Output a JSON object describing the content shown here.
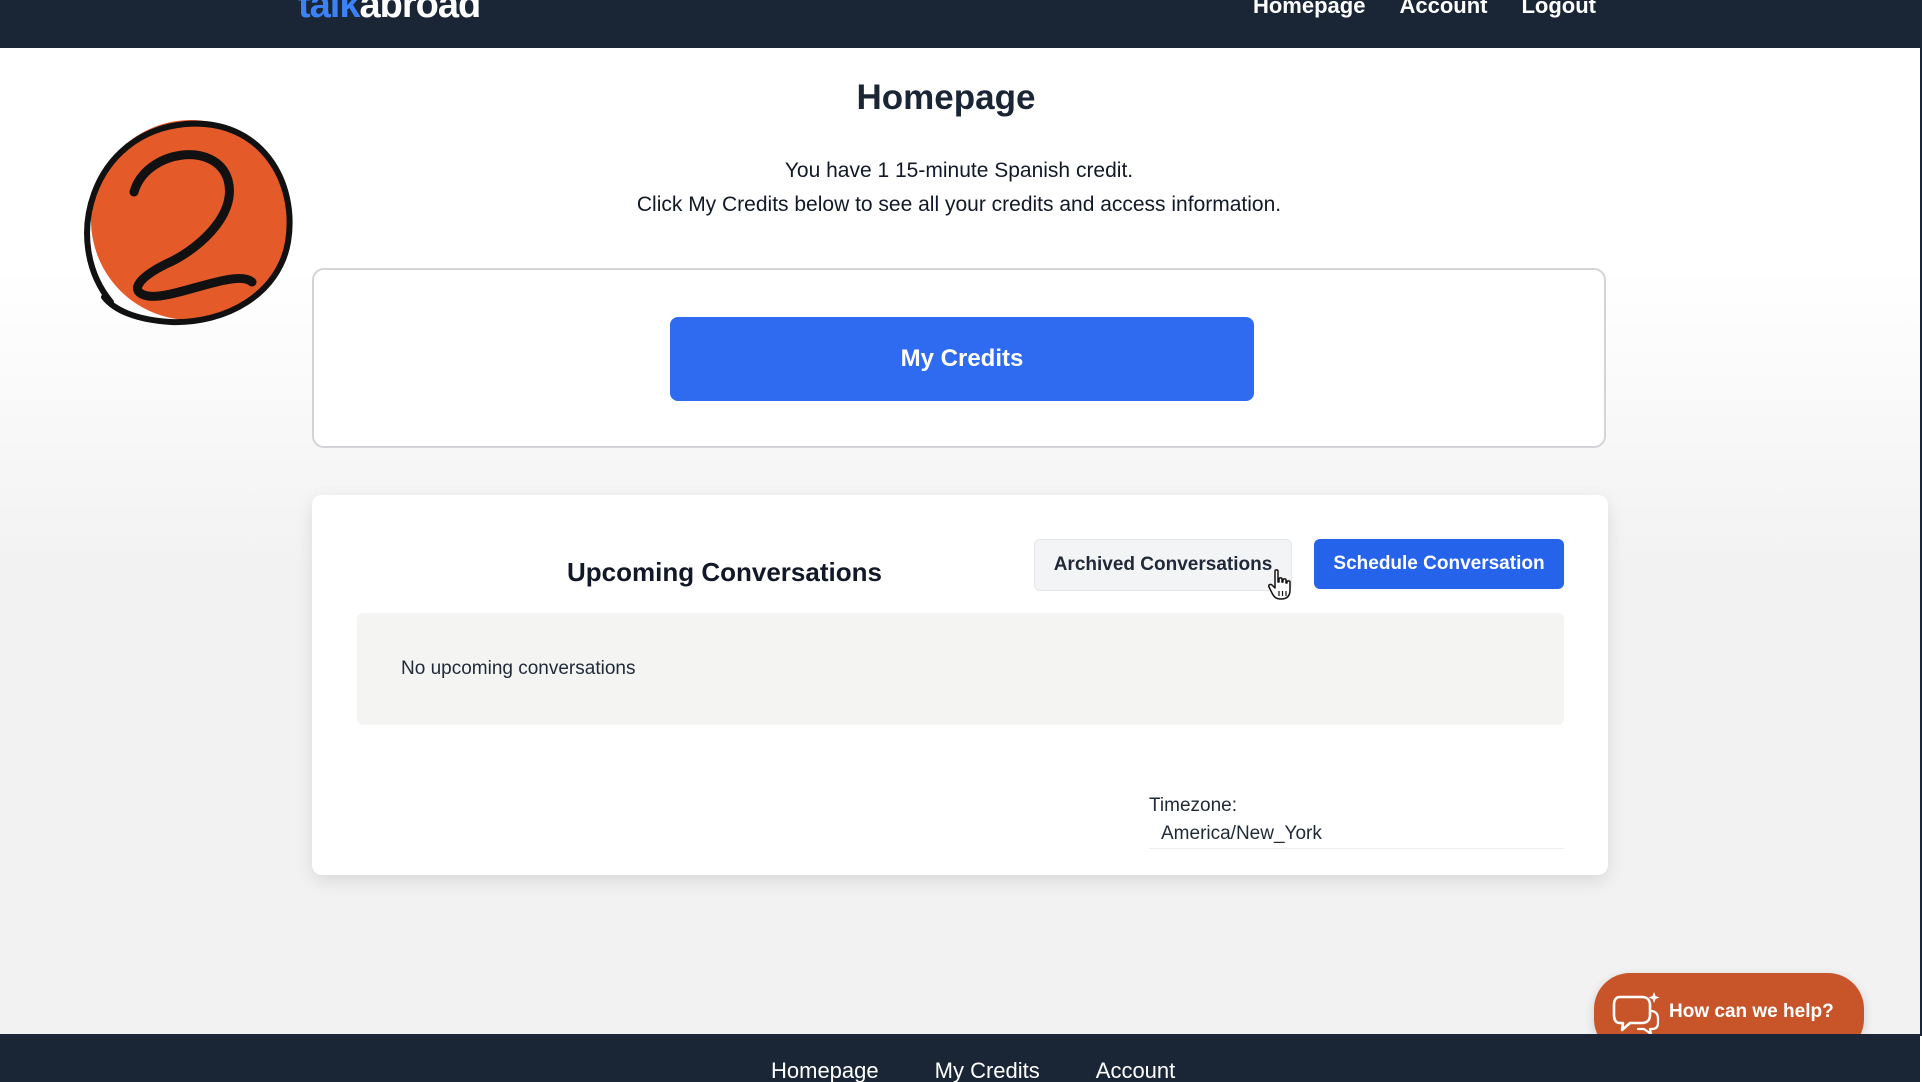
{
  "brand": {
    "logo_part_a": "talk",
    "logo_part_b": "abroad",
    "accent_color": "#3b82f6",
    "nav_color": "#1a2636"
  },
  "header": {
    "nav": [
      {
        "label": "Homepage"
      },
      {
        "label": "Account"
      },
      {
        "label": "Logout"
      }
    ]
  },
  "badge": {
    "icon": "step-2-badge-icon",
    "color": "#e55a29"
  },
  "main": {
    "title": "Homepage",
    "credit_line": "You have 1 15-minute Spanish credit.",
    "credit_hint": "Click My Credits below to see all your credits and access information."
  },
  "credits_card": {
    "button_label": "My Credits",
    "button_color": "#2f6bf0"
  },
  "conversations": {
    "title": "Upcoming Conversations",
    "archived_label": "Archived Conversations",
    "schedule_label": "Schedule Conversation",
    "empty_text": "No upcoming conversations",
    "timezone_label": "Timezone:",
    "timezone_value": "America/New_York"
  },
  "help": {
    "label": "How can we help?",
    "icon": "chat-bubbles-icon",
    "color": "#c8552a"
  },
  "footer": {
    "nav": [
      {
        "label": "Homepage"
      },
      {
        "label": "My Credits"
      },
      {
        "label": "Account"
      }
    ]
  }
}
